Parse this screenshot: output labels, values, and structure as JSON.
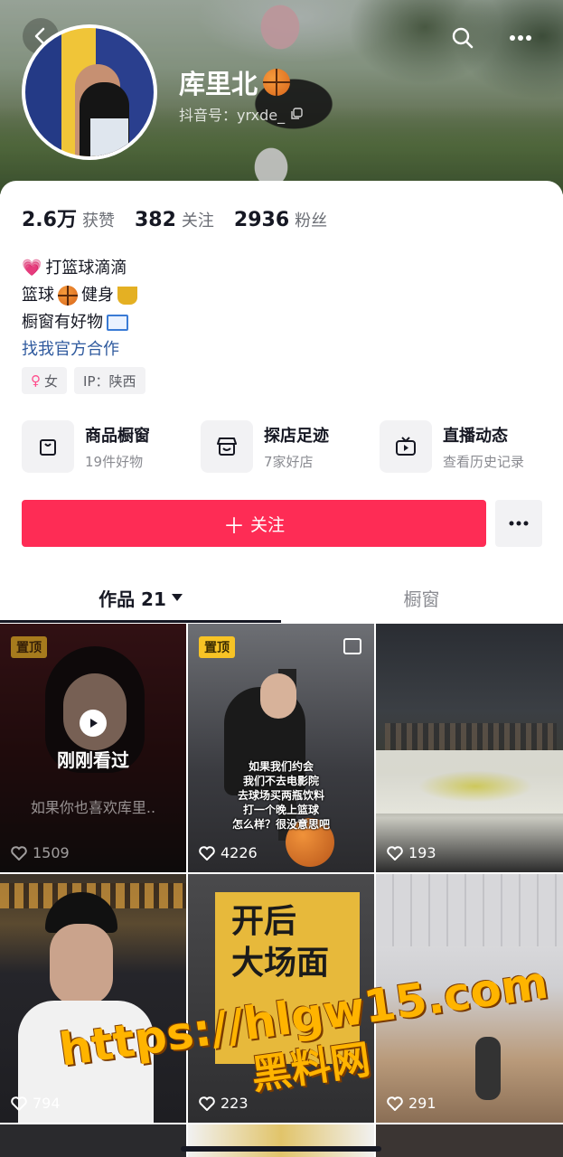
{
  "header": {
    "name": "库里北",
    "douyin_id": "抖音号：yrxde_"
  },
  "stats": [
    {
      "num": "2.6万",
      "label": "获赞"
    },
    {
      "num": "382",
      "label": "关注"
    },
    {
      "num": "2936",
      "label": "粉丝"
    }
  ],
  "bio": {
    "line1": "打篮球滴滴",
    "line2a": "篮球",
    "line2b": "健身",
    "line3": "橱窗有好物",
    "link": "找我官方合作"
  },
  "tags": {
    "gender": "女",
    "ip": "IP：陕西"
  },
  "features": [
    {
      "title": "商品橱窗",
      "sub": "19件好物"
    },
    {
      "title": "探店足迹",
      "sub": "7家好店"
    },
    {
      "title": "直播动态",
      "sub": "查看历史记录"
    }
  ],
  "actions": {
    "follow_label": "关注"
  },
  "tabs": {
    "works_label": "作品 21",
    "window_label": "橱窗"
  },
  "grid": {
    "pinned_label": "置顶",
    "watched_label": "刚刚看过",
    "watched_sub": "如果你也喜欢库里..",
    "caption2": "如果我们约会\n我们不去电影院\n去球场买两瓶饮料\n打一个晚上篮球\n怎么样？很没意思吧",
    "poster_text": "开后\n大场面",
    "likes": [
      "1509",
      "4226",
      "193",
      "794",
      "223",
      "291"
    ]
  },
  "watermark": {
    "url": "https://hlgw15.com",
    "site": "黑料网"
  },
  "colors": {
    "accent": "#fe2c55",
    "link": "#2f5a9e",
    "pin": "#f7c325"
  }
}
